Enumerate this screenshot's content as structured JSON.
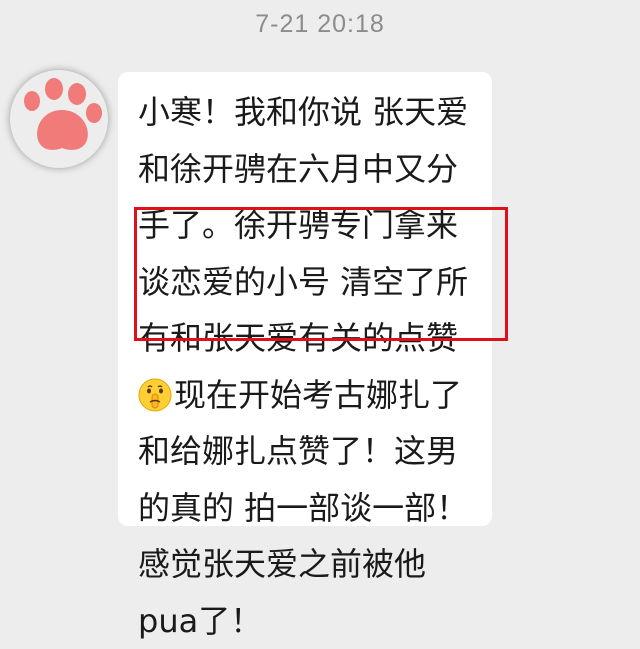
{
  "header": {
    "timestamp": "7-21 20:18"
  },
  "message": {
    "sender_avatar_icon": "cat-paw-icon",
    "lines": [
      "小寒！我和你说 张天爱",
      "和徐开骋在六月中又分",
      "手了。徐开骋专门拿来",
      "谈恋爱的小号 清空了所",
      "有和张天爱有关的点赞",
      "现在开始考古娜扎了",
      "和给娜扎点赞了！这男",
      "的真的 拍一部谈一部！",
      "感觉张天爱之前被他",
      "pua了！"
    ],
    "emoji_icon": "shushing-face-emoji",
    "highlight_color": "#e0101a",
    "bubble_color": "#ffffff",
    "background_color": "#ededed"
  }
}
